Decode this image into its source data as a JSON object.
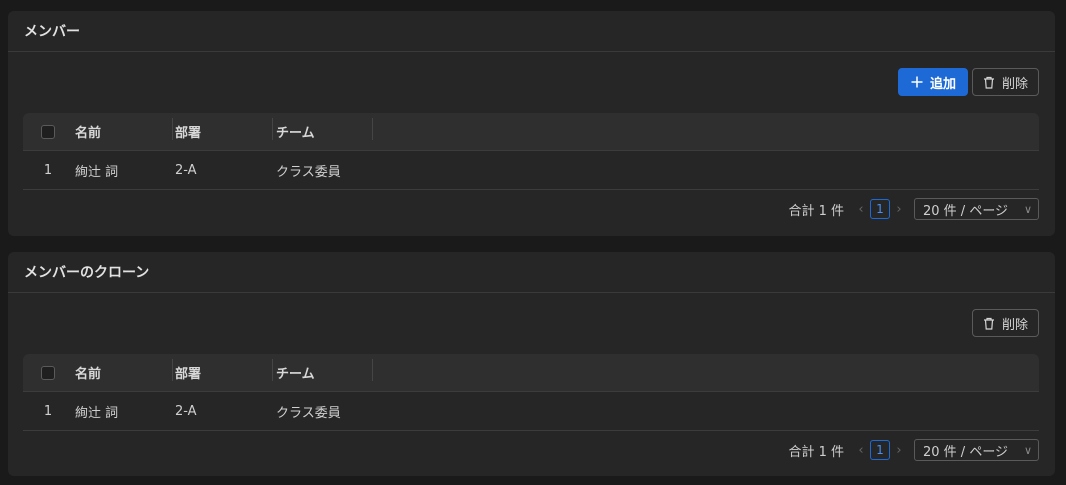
{
  "panels": [
    {
      "title": "メンバー",
      "add_label": "追加",
      "delete_label": "削除",
      "columns": [
        "名前",
        "部署",
        "チーム"
      ],
      "rows": [
        {
          "index": "1",
          "name": "絢辻 詞",
          "dept": "2-A",
          "team": "クラス委員"
        }
      ],
      "pager": {
        "total": "合計 1 件",
        "page": "1",
        "size": "20 件 / ページ"
      }
    },
    {
      "title": "メンバーのクローン",
      "delete_label": "削除",
      "columns": [
        "名前",
        "部署",
        "チーム"
      ],
      "rows": [
        {
          "index": "1",
          "name": "絢辻 詞",
          "dept": "2-A",
          "team": "クラス委員"
        }
      ],
      "pager": {
        "total": "合計 1 件",
        "page": "1",
        "size": "20 件 / ページ"
      }
    }
  ],
  "icons": {
    "add": "plus-icon",
    "delete": "trash-icon",
    "prev": "chevron-left-icon",
    "next": "chevron-right-icon",
    "dropdown": "chevron-down-icon"
  },
  "colors": {
    "primary": "#1d6ad6",
    "background": "#1a1a1a",
    "card": "#262626"
  }
}
